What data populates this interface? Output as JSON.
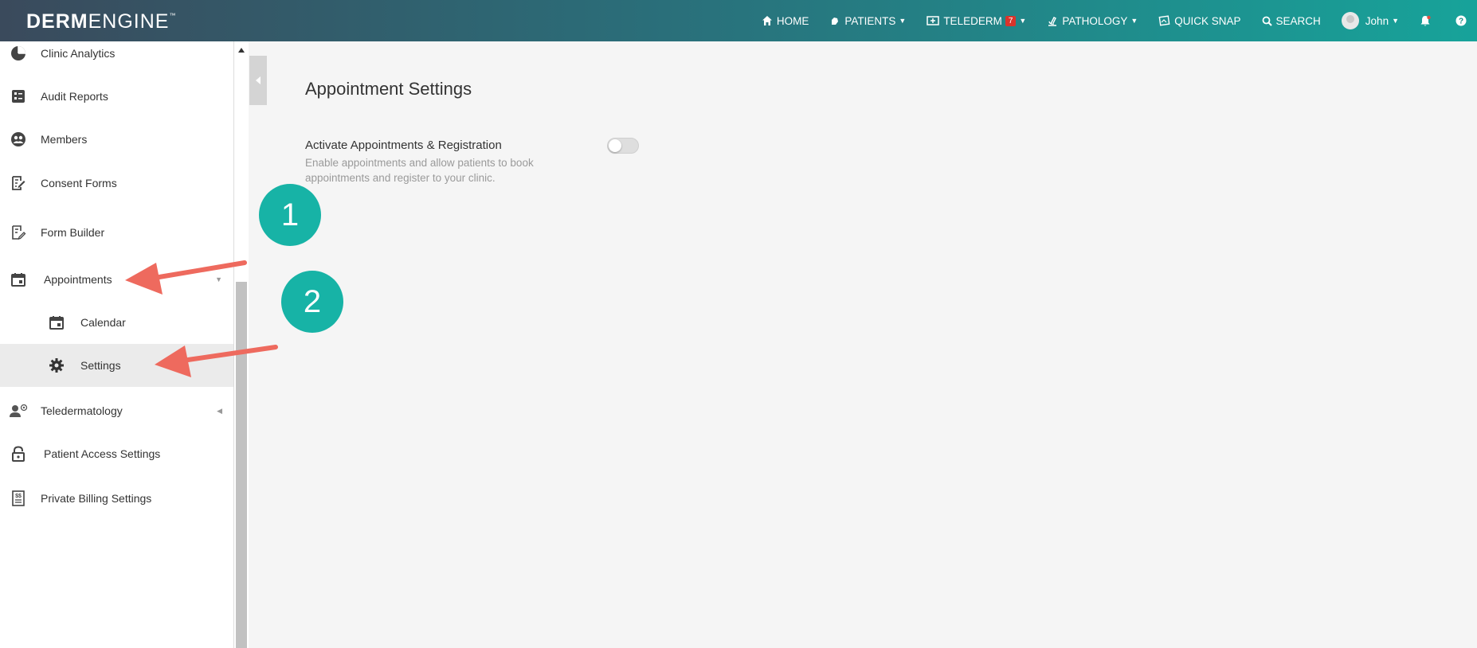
{
  "brand": {
    "derm": "DERM",
    "engine": "ENGINE",
    "tm": "™"
  },
  "nav": {
    "home": "HOME",
    "patients": "PATIENTS",
    "telederm": "TELEDERM",
    "telederm_badge": "7",
    "pathology": "PATHOLOGY",
    "quick_snap": "QUICK SNAP",
    "search": "SEARCH",
    "user": "John"
  },
  "sidebar": {
    "items": [
      {
        "label": "Clinic Analytics",
        "icon": "pie-chart-icon"
      },
      {
        "label": "Audit Reports",
        "icon": "list-report-icon"
      },
      {
        "label": "Members",
        "icon": "members-icon"
      },
      {
        "label": "Consent Forms",
        "icon": "edit-document-icon"
      },
      {
        "label": "Form Builder",
        "icon": "form-builder-icon"
      },
      {
        "label": "Appointments",
        "icon": "calendar-icon"
      },
      {
        "label": "Calendar",
        "icon": "calendar-icon"
      },
      {
        "label": "Settings",
        "icon": "gear-icon"
      },
      {
        "label": "Teledermatology",
        "icon": "teledermatology-icon"
      },
      {
        "label": "Patient Access Settings",
        "icon": "lock-icon"
      },
      {
        "label": "Private Billing Settings",
        "icon": "billing-icon"
      }
    ]
  },
  "main": {
    "title": "Appointment Settings",
    "setting": {
      "title": "Activate Appointments & Registration",
      "description": "Enable appointments and allow patients to book appointments and register to your clinic.",
      "enabled": false
    }
  },
  "annotations": {
    "step1": "1",
    "step2": "2"
  },
  "colors": {
    "accent": "#17b3a6",
    "arrow": "#ee6a5e",
    "badge": "#d9342b"
  }
}
